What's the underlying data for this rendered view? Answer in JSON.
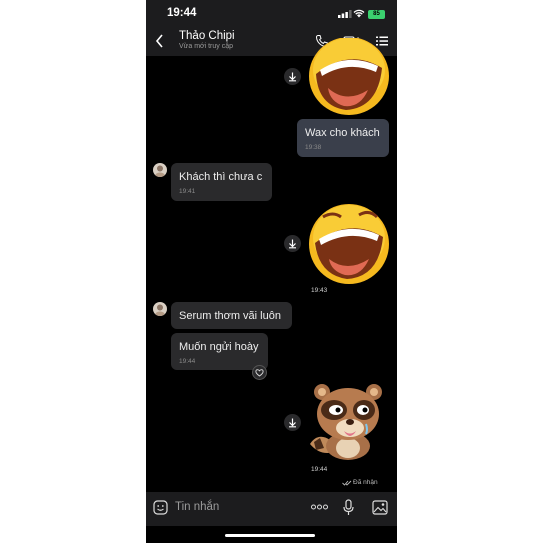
{
  "status": {
    "time": "19:44",
    "battery": "85"
  },
  "header": {
    "title": "Thảo Chipi",
    "subtitle": "Vừa mới truy cập"
  },
  "messages": {
    "m1": {
      "text": "Wax cho khách",
      "time": "19:38"
    },
    "m2": {
      "text": "Khách thì chưa c",
      "time": "19:41"
    },
    "sticker2_time": "19:43",
    "m3": {
      "text": "Serum thơm vãi luôn"
    },
    "m4": {
      "text": "Muốn ngửi hoày",
      "time": "19:44"
    },
    "sticker3_time": "19:44",
    "delivered": "Đã nhận"
  },
  "input": {
    "placeholder": "Tin nhắn"
  },
  "colors": {
    "background": "#000000",
    "bar": "#1c1c1e",
    "bubble_out": "#3a3f4b",
    "bubble_in": "#2a2a2c"
  }
}
